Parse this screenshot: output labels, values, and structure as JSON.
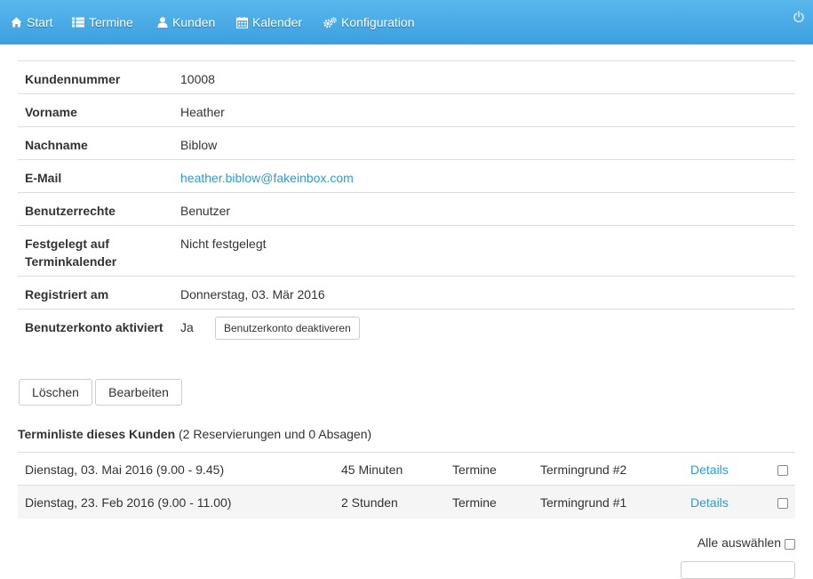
{
  "nav": {
    "start": "Start",
    "termine": "Termine",
    "kunden": "Kunden",
    "kalender": "Kalender",
    "konfiguration": "Konfiguration"
  },
  "customer": {
    "fields": [
      {
        "label": "Kundennummer",
        "value": "10008"
      },
      {
        "label": "Vorname",
        "value": "Heather"
      },
      {
        "label": "Nachname",
        "value": "Biblow"
      },
      {
        "label": "E-Mail",
        "value": "heather.biblow@fakeinbox.com"
      },
      {
        "label": "Benutzerrechte",
        "value": "Benutzer"
      },
      {
        "label": "Festgelegt auf Terminkalender",
        "value": "Nicht festgelegt"
      },
      {
        "label": "Registriert am",
        "value": "Donnerstag, 03. Mär 2016"
      },
      {
        "label": "Benutzerkonto aktiviert",
        "value": "Ja"
      }
    ],
    "deactivate_label": "Benutzerkonto deaktiveren"
  },
  "actions": {
    "delete_label": "Löschen",
    "edit_label": "Bearbeiten"
  },
  "appointments": {
    "heading": "Terminliste dieses Kunden",
    "summary": "(2 Reservierungen und 0 Absagen)",
    "rows": [
      {
        "date": "Dienstag, 03. Mai 2016 (9.00 - 9.45)",
        "duration": "45 Minuten",
        "type": "Termine",
        "reason": "Termingrund #2",
        "details": "Details"
      },
      {
        "date": "Dienstag, 23. Feb 2016 (9.00 - 11.00)",
        "duration": "2 Stunden",
        "type": "Termine",
        "reason": "Termingrund #1",
        "details": "Details"
      }
    ],
    "select_all_label": "Alle auswählen"
  },
  "colors": {
    "navbar": "#4aaae6",
    "link": "#2e9bd6"
  }
}
